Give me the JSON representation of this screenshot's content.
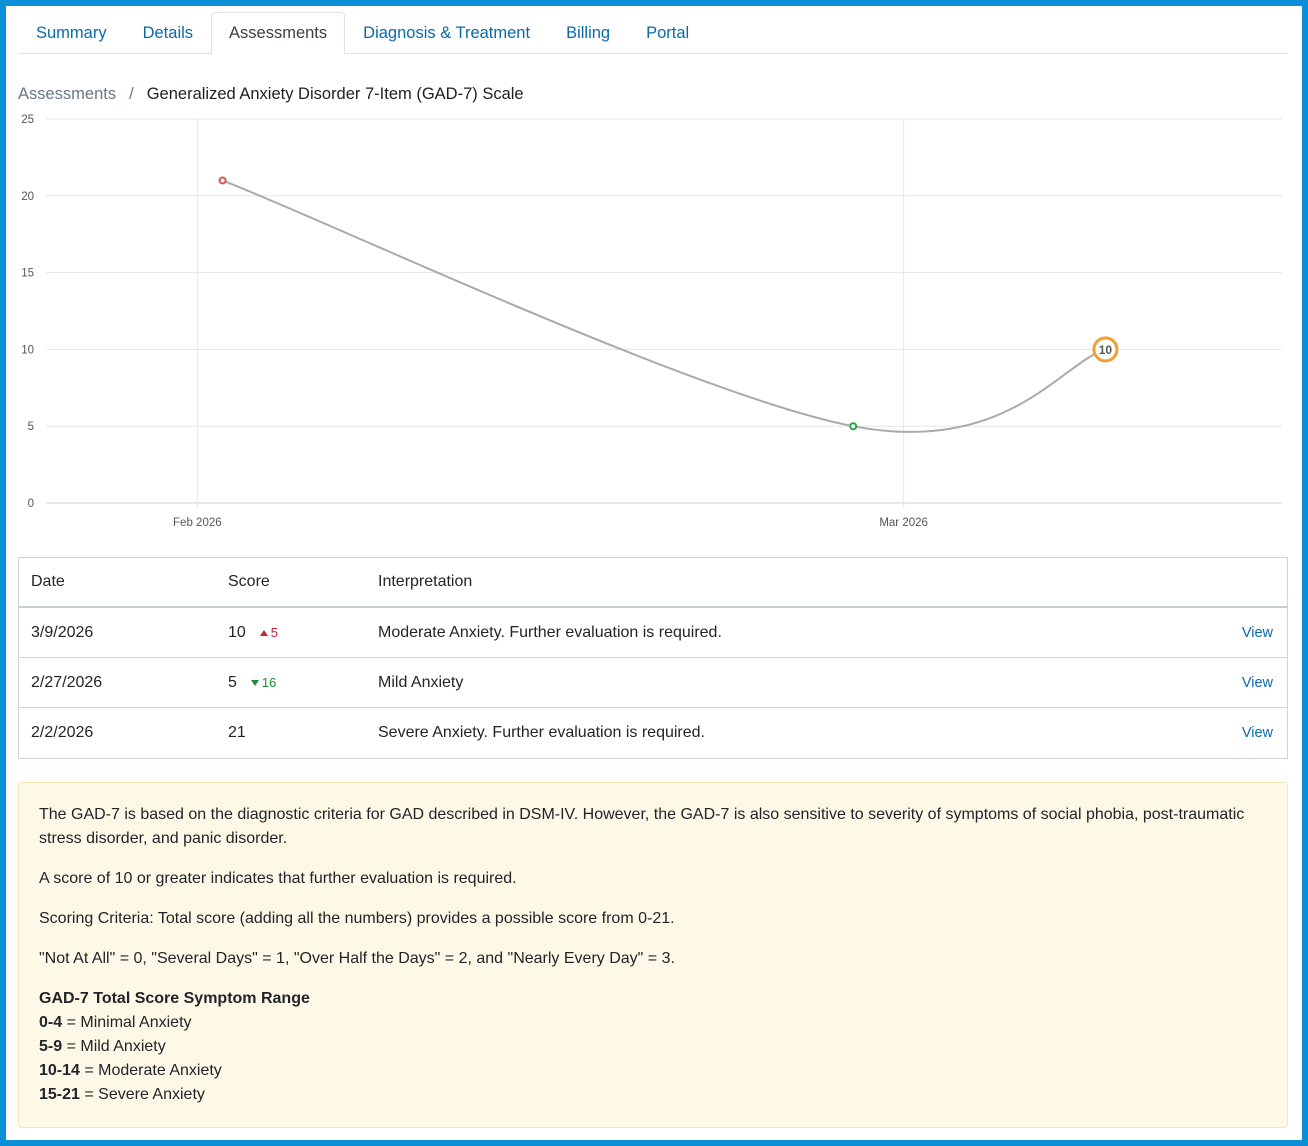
{
  "tabs": [
    {
      "label": "Summary",
      "active": false
    },
    {
      "label": "Details",
      "active": false
    },
    {
      "label": "Assessments",
      "active": true
    },
    {
      "label": "Diagnosis & Treatment",
      "active": false
    },
    {
      "label": "Billing",
      "active": false
    },
    {
      "label": "Portal",
      "active": false
    }
  ],
  "breadcrumb": {
    "parent": "Assessments",
    "separator": "/",
    "current": "Generalized Anxiety Disorder 7-Item (GAD-7) Scale"
  },
  "chart_data": {
    "type": "line",
    "title": "",
    "xlabel": "",
    "ylabel": "",
    "ylim": [
      0,
      25
    ],
    "yticks": [
      0,
      5,
      10,
      15,
      20,
      25
    ],
    "xticks": [
      {
        "label": "Feb 2026",
        "date": "2026-02-01"
      },
      {
        "label": "Mar 2026",
        "date": "2026-03-01"
      }
    ],
    "grid": true,
    "series": [
      {
        "points": [
          {
            "date": "2026-02-02",
            "y": 21,
            "color": "#d9534f"
          },
          {
            "date": "2026-02-27",
            "y": 5,
            "color": "#28a745"
          },
          {
            "date": "2026-03-09",
            "y": 10,
            "color": "#f0a030",
            "highlighted": true,
            "label": "10"
          }
        ],
        "line_color": "#aaaaaa"
      }
    ]
  },
  "table": {
    "headers": {
      "date": "Date",
      "score": "Score",
      "interpretation": "Interpretation"
    },
    "rows": [
      {
        "date": "3/9/2026",
        "score": "10",
        "delta": "5",
        "delta_dir": "up",
        "interpretation": "Moderate Anxiety. Further evaluation is required.",
        "action": "View"
      },
      {
        "date": "2/27/2026",
        "score": "5",
        "delta": "16",
        "delta_dir": "down",
        "interpretation": "Mild Anxiety",
        "action": "View"
      },
      {
        "date": "2/2/2026",
        "score": "21",
        "delta": "",
        "delta_dir": "",
        "interpretation": "Severe Anxiety. Further evaluation is required.",
        "action": "View"
      }
    ]
  },
  "info": {
    "p1": "The GAD-7 is based on the diagnostic criteria for GAD described in DSM-IV. However, the GAD-7 is also sensitive to severity of symptoms of social phobia, post-traumatic stress disorder, and panic disorder.",
    "p2": "A score of 10 or greater indicates that further evaluation is required.",
    "p3": "Scoring Criteria: Total score (adding all the numbers) provides a possible score from 0-21.",
    "p4": "\"Not At All\" = 0, \"Several Days\" = 1, \"Over Half the Days\" = 2, and \"Nearly Every Day\" = 3.",
    "range_title": "GAD-7 Total Score Symptom Range",
    "ranges": [
      {
        "range": "0-4",
        "label": " = Minimal Anxiety"
      },
      {
        "range": "5-9",
        "label": " = Mild Anxiety"
      },
      {
        "range": "10-14",
        "label": " = Moderate Anxiety"
      },
      {
        "range": "15-21",
        "label": " = Severe Anxiety"
      }
    ]
  }
}
